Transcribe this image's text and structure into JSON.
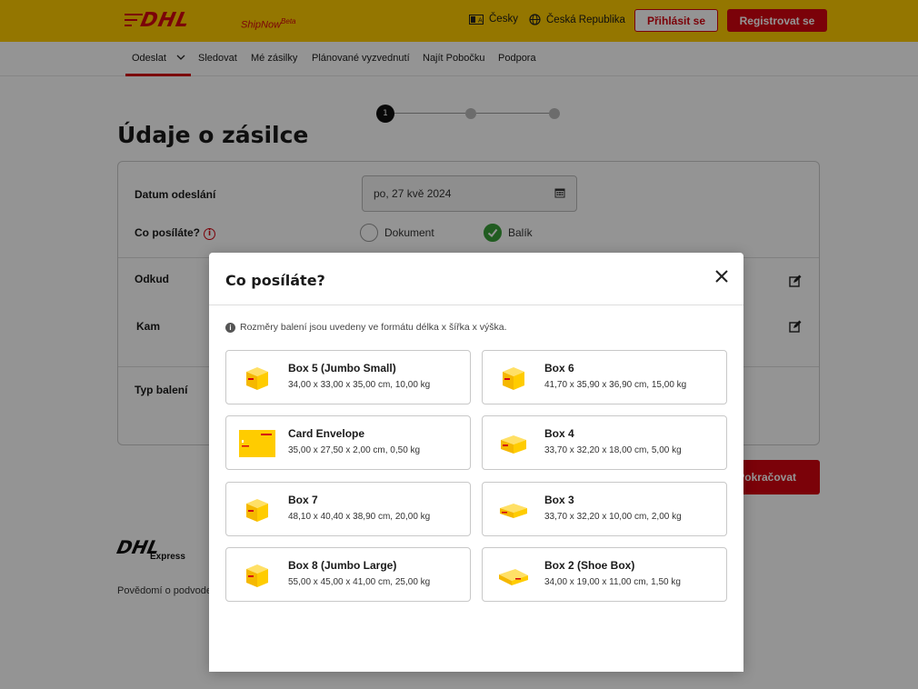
{
  "header": {
    "logo": "DHL",
    "shipnow": "ShipNow",
    "shipnow_beta": "Beta",
    "language": "Česky",
    "country": "Česká Republika",
    "login_label": "Přihlásit se",
    "register_label": "Registrovat se"
  },
  "nav": {
    "items": [
      {
        "label": "Odeslat"
      },
      {
        "label": "Sledovat"
      },
      {
        "label": "Mé zásilky"
      },
      {
        "label": "Plánované vyzvednutí"
      },
      {
        "label": "Najít Pobočku"
      },
      {
        "label": "Podpora"
      }
    ]
  },
  "stepper": {
    "current": "1"
  },
  "page": {
    "title": "Údaje o zásilce",
    "date_label": "Datum odeslání",
    "date_value": "po, 27 kvě 2024",
    "what_label": "Co posíláte?",
    "option_document": "Dokument",
    "option_package": "Balík",
    "from_label": "Odkud",
    "to_label": "Kam",
    "packaging_label": "Typ balení",
    "continue_label": "Pokračovat"
  },
  "footer": {
    "logo": "DHL",
    "express": "Express",
    "text": "Povědomí o podvode"
  },
  "modal": {
    "title": "Co posíláte?",
    "info": "Rozměry balení jsou uvedeny ve formátu délka x šířka x výška.",
    "items": [
      {
        "name": "Box 5 (Jumbo Small)",
        "dims": "34,00 x 33,00 x 35,00 cm, 10,00 kg"
      },
      {
        "name": "Box 6",
        "dims": "41,70 x 35,90 x 36,90 cm, 15,00 kg"
      },
      {
        "name": "Card Envelope",
        "dims": "35,00 x 27,50 x 2,00 cm, 0,50 kg"
      },
      {
        "name": "Box 4",
        "dims": "33,70 x 32,20 x 18,00 cm, 5,00 kg"
      },
      {
        "name": "Box 7",
        "dims": "48,10 x 40,40 x 38,90 cm, 20,00 kg"
      },
      {
        "name": "Box 3",
        "dims": "33,70 x 32,20 x 10,00 cm, 2,00 kg"
      },
      {
        "name": "Box 8 (Jumbo Large)",
        "dims": "55,00 x 45,00 x 41,00 cm, 25,00 kg"
      },
      {
        "name": "Box 2 (Shoe Box)",
        "dims": "34,00 x 19,00 x 11,00 cm, 1,50 kg"
      }
    ]
  },
  "colors": {
    "brand_yellow": "#ffcc00",
    "brand_red": "#d40511",
    "success_green": "#3a9f3a"
  }
}
